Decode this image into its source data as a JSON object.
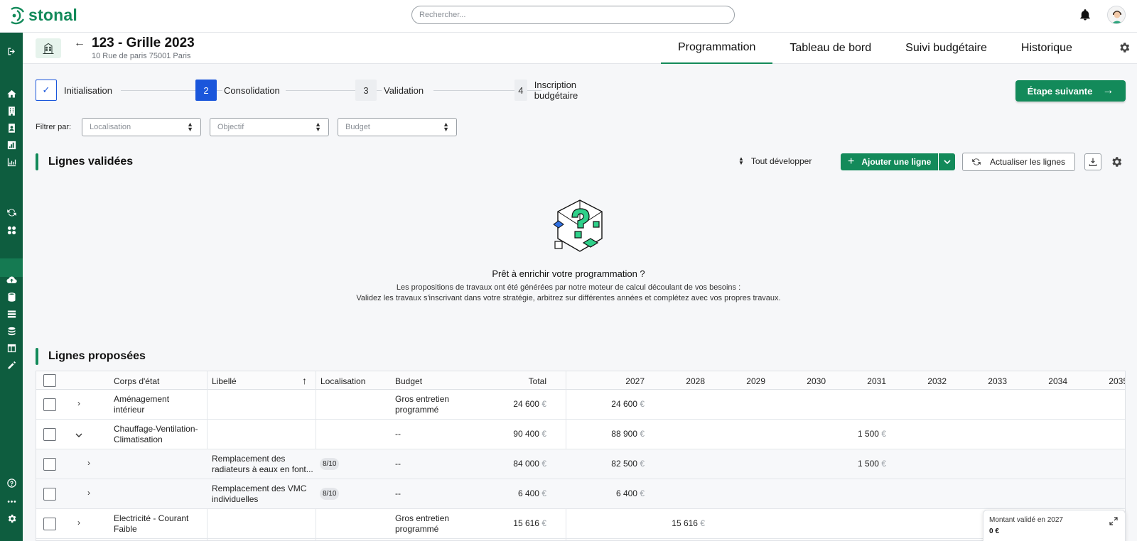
{
  "app": {
    "logo_text": "stonal",
    "search_placeholder": "Rechercher...",
    "brand_color": "#138a5a",
    "sidebar_color": "#0e5d3f"
  },
  "header": {
    "title": "123 - Grille 2023",
    "address": "10 Rue de paris 75001 Paris",
    "back_icon": "arrow-left-icon",
    "tabs": [
      {
        "label": "Programmation",
        "active": true
      },
      {
        "label": "Tableau de bord",
        "active": false
      },
      {
        "label": "Suivi budgétaire",
        "active": false
      },
      {
        "label": "Historique",
        "active": false
      }
    ]
  },
  "stepper": {
    "steps": [
      {
        "number": "✓",
        "label": "Initialisation",
        "state": "done"
      },
      {
        "number": "2",
        "label": "Consolidation",
        "state": "current"
      },
      {
        "number": "3",
        "label": "Validation",
        "state": "todo"
      },
      {
        "number": "4",
        "label": "Inscription budgétaire",
        "state": "todo"
      }
    ],
    "next_label": "Étape suivante"
  },
  "filters": {
    "label": "Filtrer par:",
    "selects": [
      {
        "placeholder": "Localisation"
      },
      {
        "placeholder": "Objectif"
      },
      {
        "placeholder": "Budget"
      }
    ]
  },
  "validated": {
    "title": "Lignes validées",
    "expand_all": "Tout développer",
    "add_line": "Ajouter une ligne",
    "refresh": "Actualiser les lignes",
    "empty_title": "Prêt à enrichir votre programmation ?",
    "empty_line1": "Les propositions de travaux ont été générées par notre moteur de calcul découlant de vos besoins :",
    "empty_line2": "Validez les travaux s'inscrivant dans votre stratégie, arbitrez sur différentes années et complétez avec vos propres travaux."
  },
  "proposed": {
    "title": "Lignes proposées",
    "columns": {
      "corps": "Corps d'état",
      "libelle": "Libellé",
      "localisation": "Localisation",
      "budget": "Budget",
      "total": "Total",
      "years": [
        "2027",
        "2028",
        "2029",
        "2030",
        "2031",
        "2032",
        "2033",
        "2034",
        "2035"
      ]
    },
    "rows": [
      {
        "level": 0,
        "expanded": false,
        "corps": [
          "Aménagement",
          "intérieur"
        ],
        "libelle": [
          "",
          ""
        ],
        "loc": "",
        "budget": [
          "Gros entretien",
          "programmé"
        ],
        "total": "24 600",
        "y2027": "24 600",
        "y2028": "",
        "y2031": ""
      },
      {
        "level": 0,
        "expanded": true,
        "corps": [
          "Chauffage-Ventilation-",
          "Climatisation"
        ],
        "libelle": [
          "",
          ""
        ],
        "loc": "",
        "budget": [
          "--",
          ""
        ],
        "total": "90 400",
        "y2027": "88 900",
        "y2028": "",
        "y2031": "1 500"
      },
      {
        "level": 1,
        "expanded": false,
        "corps": [
          "",
          ""
        ],
        "libelle": [
          "Remplacement des",
          "radiateurs à eaux en font..."
        ],
        "loc": "8/10",
        "budget": [
          "--",
          ""
        ],
        "total": "84 000",
        "y2027": "82 500",
        "y2028": "",
        "y2031": "1 500"
      },
      {
        "level": 1,
        "expanded": false,
        "corps": [
          "",
          ""
        ],
        "libelle": [
          "Remplacement des VMC",
          "individuelles"
        ],
        "loc": "8/10",
        "budget": [
          "--",
          ""
        ],
        "total": "6 400",
        "y2027": "6 400",
        "y2028": "",
        "y2031": ""
      },
      {
        "level": 0,
        "expanded": false,
        "corps": [
          "Electricité - Courant",
          "Faible"
        ],
        "libelle": [
          "",
          ""
        ],
        "loc": "",
        "budget": [
          "Gros entretien",
          "programmé"
        ],
        "total": "15 616",
        "y2027": "",
        "y2028": "15 616",
        "y2031": ""
      }
    ],
    "currency": "€"
  },
  "floating": {
    "label": "Montant validé en 2027",
    "value": "0 €"
  }
}
